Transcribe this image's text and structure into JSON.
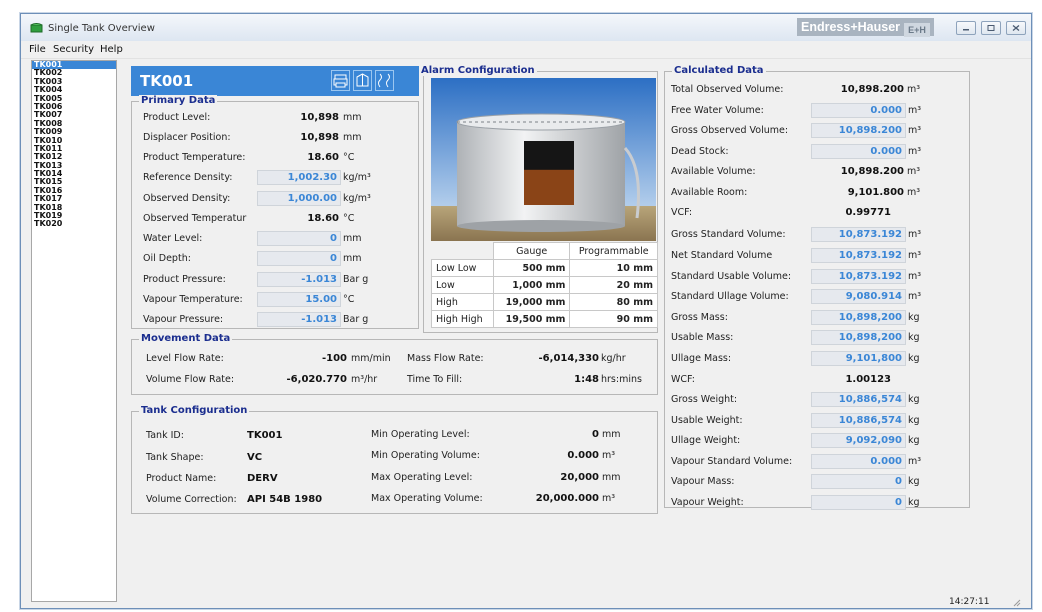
{
  "window": {
    "title": "Single Tank Overview",
    "brand": "Endress+Hauser",
    "brand_logo": "E+H"
  },
  "menu": {
    "file": "File",
    "security": "Security",
    "help": "Help"
  },
  "tanks": [
    "TK001",
    "TK002",
    "TK003",
    "TK004",
    "TK005",
    "TK006",
    "TK007",
    "TK008",
    "TK009",
    "TK010",
    "TK011",
    "TK012",
    "TK013",
    "TK014",
    "TK015",
    "TK016",
    "TK017",
    "TK018",
    "TK019",
    "TK020"
  ],
  "selected_tank": "TK001",
  "header": {
    "tank": "TK001"
  },
  "primary": {
    "title": "Primary Data",
    "product_level": {
      "label": "Product Level:",
      "value": "10,898",
      "unit": "mm"
    },
    "displacer_position": {
      "label": "Displacer Position:",
      "value": "10,898",
      "unit": "mm"
    },
    "product_temperature": {
      "label": "Product Temperature:",
      "value": "18.60",
      "unit": "°C"
    },
    "reference_density": {
      "label": "Reference Density:",
      "value": "1,002.30",
      "unit": "kg/m³"
    },
    "observed_density": {
      "label": "Observed Density:",
      "value": "1,000.00",
      "unit": "kg/m³"
    },
    "observed_temperature": {
      "label": "Observed Temperatur",
      "value": "18.60",
      "unit": "°C"
    },
    "water_level": {
      "label": "Water Level:",
      "value": "0",
      "unit": "mm"
    },
    "oil_depth": {
      "label": "Oil Depth:",
      "value": "0",
      "unit": "mm"
    },
    "product_pressure": {
      "label": "Product Pressure:",
      "value": "-1.013",
      "unit": "Bar g"
    },
    "vapour_temperature": {
      "label": "Vapour Temperature:",
      "value": "15.00",
      "unit": "°C"
    },
    "vapour_pressure": {
      "label": "Vapour Pressure:",
      "value": "-1.013",
      "unit": "Bar g"
    }
  },
  "movement": {
    "title": "Movement Data",
    "level_flow_rate": {
      "label": "Level Flow Rate:",
      "value": "-100",
      "unit": "mm/min"
    },
    "volume_flow_rate": {
      "label": "Volume Flow Rate:",
      "value": "-6,020.770",
      "unit": "m³/hr"
    },
    "mass_flow_rate": {
      "label": "Mass Flow Rate:",
      "value": "-6,014,330",
      "unit": "kg/hr"
    },
    "time_to_fill": {
      "label": "Time To Fill:",
      "value": "1:48",
      "unit": "hrs:mins"
    }
  },
  "config": {
    "title": "Tank Configuration",
    "tank_id": {
      "label": "Tank ID:",
      "value": "TK001"
    },
    "tank_shape": {
      "label": "Tank Shape:",
      "value": "VC"
    },
    "product_name": {
      "label": "Product Name:",
      "value": "DERV"
    },
    "volume_correction": {
      "label": "Volume Correction:",
      "value": "API 54B 1980"
    },
    "min_op_level": {
      "label": "Min Operating Level:",
      "value": "0",
      "unit": "mm"
    },
    "min_op_volume": {
      "label": "Min Operating Volume:",
      "value": "0.000",
      "unit": "m³"
    },
    "max_op_level": {
      "label": "Max Operating Level:",
      "value": "20,000",
      "unit": "mm"
    },
    "max_op_volume": {
      "label": "Max Operating Volume:",
      "value": "20,000.000",
      "unit": "m³"
    }
  },
  "alarm": {
    "title": "Alarm Configuration",
    "col_gauge": "Gauge",
    "col_programmable": "Programmable",
    "rows": [
      {
        "label": "Low Low",
        "gauge": "500 mm",
        "prog": "10 mm"
      },
      {
        "label": "Low",
        "gauge": "1,000 mm",
        "prog": "20 mm"
      },
      {
        "label": "High",
        "gauge": "19,000 mm",
        "prog": "80 mm"
      },
      {
        "label": "High High",
        "gauge": "19,500 mm",
        "prog": "90 mm"
      }
    ],
    "tank_fill": {
      "product_fraction": 0.55
    }
  },
  "calc": {
    "title": "Calculated Data",
    "tov": {
      "label": "Total Observed Volume:",
      "value": "10,898.200",
      "unit": "m³"
    },
    "fwv": {
      "label": "Free Water Volume:",
      "value": "0.000",
      "unit": "m³"
    },
    "gov": {
      "label": "Gross Observed Volume:",
      "value": "10,898.200",
      "unit": "m³"
    },
    "dead_stock": {
      "label": "Dead Stock:",
      "value": "0.000",
      "unit": "m³"
    },
    "available_volume": {
      "label": "Available Volume:",
      "value": "10,898.200",
      "unit": "m³"
    },
    "available_room": {
      "label": "Available Room:",
      "value": "9,101.800",
      "unit": "m³"
    },
    "vcf": {
      "label": "VCF:",
      "value": "0.99771"
    },
    "gsv": {
      "label": "Gross Standard Volume:",
      "value": "10,873.192",
      "unit": "m³"
    },
    "nsv": {
      "label": "Net Standard Volume",
      "value": "10,873.192",
      "unit": "m³"
    },
    "suv": {
      "label": "Standard Usable Volume:",
      "value": "10,873.192",
      "unit": "m³"
    },
    "sulv": {
      "label": "Standard Ullage Volume:",
      "value": "9,080.914",
      "unit": "m³"
    },
    "gross_mass": {
      "label": "Gross Mass:",
      "value": "10,898,200",
      "unit": "kg"
    },
    "usable_mass": {
      "label": "Usable Mass:",
      "value": "10,898,200",
      "unit": "kg"
    },
    "ullage_mass": {
      "label": "Ullage Mass:",
      "value": "9,101,800",
      "unit": "kg"
    },
    "wcf": {
      "label": "WCF:",
      "value": "1.00123"
    },
    "gross_weight": {
      "label": "Gross Weight:",
      "value": "10,886,574",
      "unit": "kg"
    },
    "usable_weight": {
      "label": "Usable Weight:",
      "value": "10,886,574",
      "unit": "kg"
    },
    "ullage_weight": {
      "label": "Ullage Weight:",
      "value": "9,092,090",
      "unit": "kg"
    },
    "vsv": {
      "label": "Vapour Standard Volume:",
      "value": "0.000",
      "unit": "m³"
    },
    "vapour_mass": {
      "label": "Vapour Mass:",
      "value": "0",
      "unit": "kg"
    },
    "vapour_weight": {
      "label": "Vapour Weight:",
      "value": "0",
      "unit": "kg"
    }
  },
  "status": {
    "time": "14:27:11"
  },
  "colors": {
    "accent": "#3a86d6",
    "panel_title": "#1b2e8f",
    "product": "#8a4417",
    "vapour": "#151515"
  }
}
